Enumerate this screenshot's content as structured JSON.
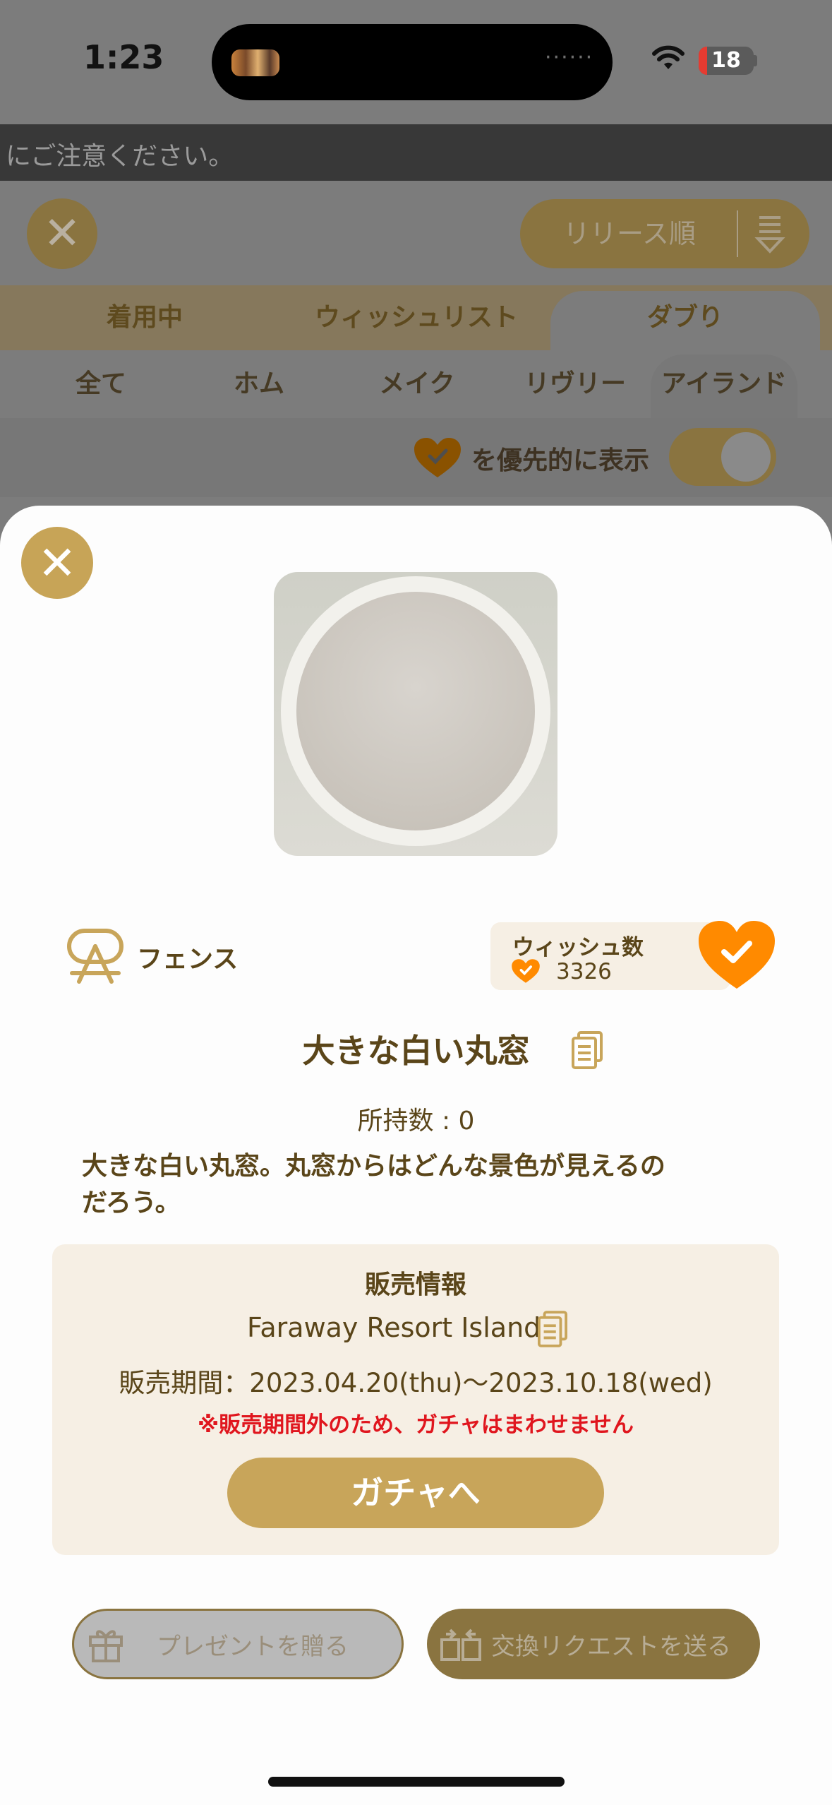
{
  "status_bar": {
    "time": "1:23",
    "battery": "18",
    "island_dots": "······"
  },
  "notice": {
    "text": "にご注意ください。"
  },
  "background_screen": {
    "close_icon": "close-icon",
    "sort": {
      "label": "リリース順",
      "icon": "sort-icon"
    },
    "tabs": [
      {
        "label": "着用中",
        "active": false
      },
      {
        "label": "ウィッシュリスト",
        "active": false
      },
      {
        "label": "ダブり",
        "active": true
      }
    ],
    "subtabs": [
      {
        "label": "全て",
        "active": false
      },
      {
        "label": "ホム",
        "active": false
      },
      {
        "label": "メイク",
        "active": false
      },
      {
        "label": "リヴリー",
        "active": false
      },
      {
        "label": "アイランド",
        "active": true
      }
    ],
    "priority_label": "を優先的に表示",
    "priority_toggle_on": true
  },
  "modal": {
    "close_icon": "close-icon",
    "category": {
      "icon": "fence-icon",
      "label": "フェンス"
    },
    "wish": {
      "label": "ウィッシュ数",
      "count": "3326",
      "wished": true
    },
    "title": "大きな白い丸窓",
    "owned": "所持数 : 0",
    "description_line1": "大きな白い丸窓。丸窓からはどんな景色が見えるの",
    "description_line2": "だろう。",
    "sales": {
      "heading": "販売情報",
      "name": "Faraway Resort Island",
      "period": "販売期間：2023.04.20(thu)〜2023.10.18(wed)",
      "note": "※販売期間外のため、ガチャはまわせません",
      "gacha_button": "ガチャへ"
    },
    "present_button": "プレゼントを贈る",
    "trade_button": "交換リクエストを送る"
  },
  "colors": {
    "accent_gold": "#c8a55a",
    "text_brown": "#5a4519",
    "heart_orange": "#ff8a00",
    "warning_red": "#e0161e",
    "panel_cream": "#f6efe4"
  }
}
